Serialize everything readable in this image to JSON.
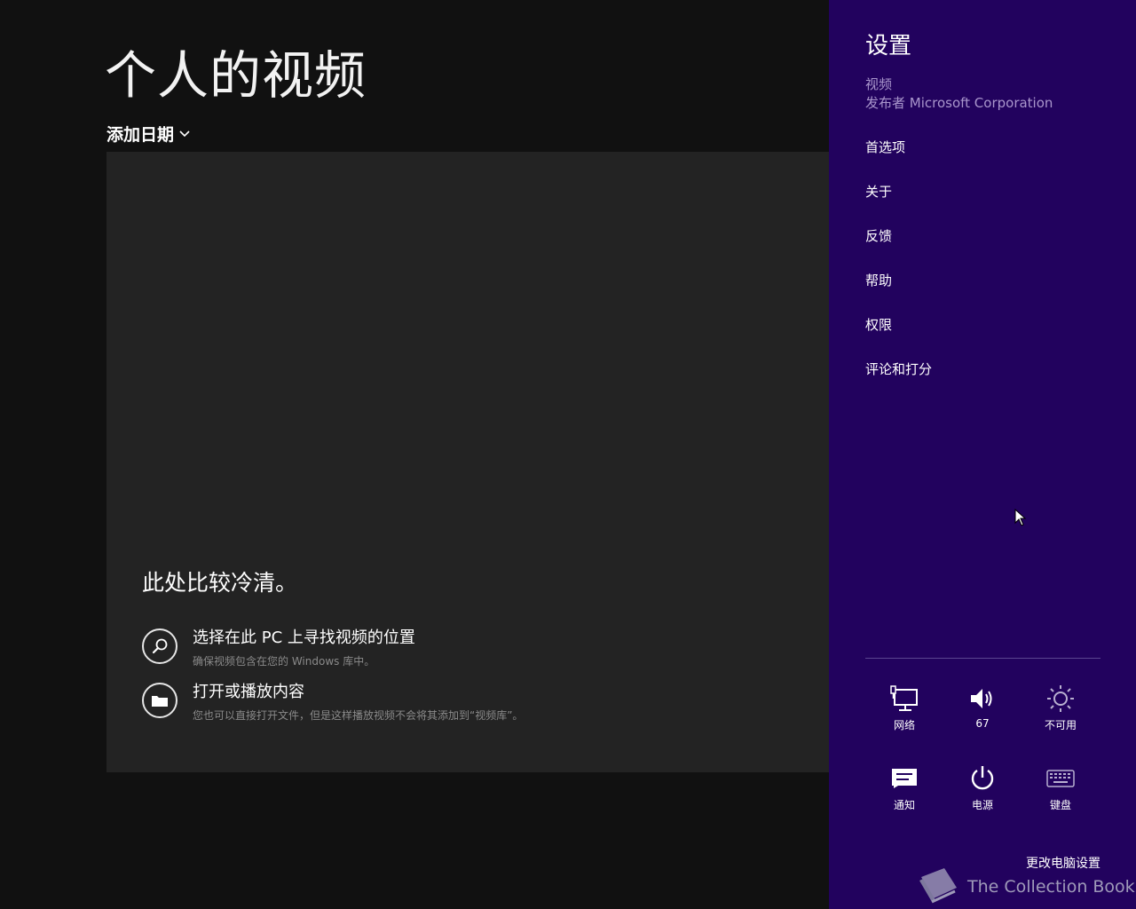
{
  "app": {
    "title": "个人的视频",
    "sort": {
      "label": "添加日期"
    },
    "empty_state": {
      "heading": "此处比较冷清。",
      "actions": [
        {
          "icon": "search-icon",
          "title": "选择在此 PC 上寻找视频的位置",
          "subtitle": "确保视频包含在您的 Windows 库中。"
        },
        {
          "icon": "folder-icon",
          "title": "打开或播放内容",
          "subtitle": "您也可以直接打开文件，但是这样播放视频不会将其添加到“视频库”。"
        }
      ]
    }
  },
  "settings_pane": {
    "title": "设置",
    "app_name": "视频",
    "publisher": "发布者 Microsoft Corporation",
    "menu": [
      "首选项",
      "关于",
      "反馈",
      "帮助",
      "权限",
      "评论和打分"
    ],
    "quick_settings": [
      {
        "icon": "network-icon",
        "label": "网络"
      },
      {
        "icon": "volume-icon",
        "label": "67"
      },
      {
        "icon": "brightness-icon",
        "label": "不可用"
      },
      {
        "icon": "notifications-icon",
        "label": "通知"
      },
      {
        "icon": "power-icon",
        "label": "电源"
      },
      {
        "icon": "keyboard-icon",
        "label": "键盘"
      }
    ],
    "change_pc_settings": "更改电脑设置"
  },
  "watermark": {
    "text": "The Collection Book"
  },
  "colors": {
    "charm_background": "#22025e",
    "app_background": "#111111",
    "panel_background": "#232323"
  }
}
